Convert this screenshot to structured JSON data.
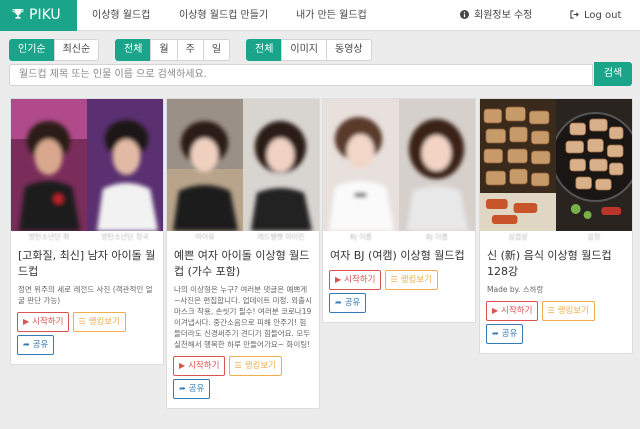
{
  "app": {
    "brand": "PIKU",
    "colors": {
      "accent": "#1aa58a",
      "start": "#d9534f",
      "rank": "#f0ad4e",
      "share": "#337ab7"
    }
  },
  "nav": {
    "items": [
      {
        "label": "이상형 월드컵"
      },
      {
        "label": "이상형 월드컵 만들기"
      },
      {
        "label": "내가 만든 월드컵"
      }
    ],
    "account": {
      "label": "회원정보 수정",
      "icon": "info-circle-icon"
    },
    "logout": {
      "label": "Log out",
      "icon": "sign-out-icon"
    }
  },
  "filters": {
    "sort": [
      {
        "label": "인기순",
        "active": true
      },
      {
        "label": "최신순",
        "active": false
      }
    ],
    "period": [
      {
        "label": "전체",
        "active": true
      },
      {
        "label": "월",
        "active": false
      },
      {
        "label": "주",
        "active": false
      },
      {
        "label": "일",
        "active": false
      }
    ],
    "type": [
      {
        "label": "전체",
        "active": true
      },
      {
        "label": "이미지",
        "active": false
      },
      {
        "label": "동영상",
        "active": false
      }
    ]
  },
  "search": {
    "placeholder": "월드컵 제목 또는 인물 이름 으로 검색하세요.",
    "button": "검색"
  },
  "cards": [
    {
      "title": "[고화질, 최신] 남자 아이돌 월드컵",
      "desc": "정면 위주의 세로 레전드 사진 (객관적인 얼굴 판단 가능)",
      "captions": [
        "방탄소년단 뷔",
        "방탄소년단 정국"
      ],
      "start": "시작하기",
      "rank": "랭킹보기",
      "share": "공유"
    },
    {
      "title": "예쁜 여자 아이돌 이상형 월드컵 (가수 포함)",
      "desc": "나의 이상형은 누구? 여러분 댓글은 예쁘게~사진은 편집합니다. 업데이트 미정. 외출시 마스크 착용, 손씻기 필수! 여러분 코로나19 이겨냅시다. 중간소음으로 피해 안주기! 힘들더라도 신경써주기 견디기 힘들어요. 모두 실천해서 행복한 하루 만들어가요~ 화이팅!",
      "captions": [
        "아이유",
        "레드벨벳 아이린"
      ],
      "start": "시작하기",
      "rank": "랭킹보기",
      "share": "공유"
    },
    {
      "title": "여자 BJ (여캠) 이상형 월드컵",
      "desc": "",
      "captions": [
        "BJ 이름",
        "BJ 이름"
      ],
      "start": "시작하기",
      "rank": "랭킹보기",
      "share": "공유"
    },
    {
      "title": "신 (新) 음식 이상형 월드컵 128강",
      "desc": "Made by. 스하랑",
      "captions": [
        "삼겹살",
        "곱창"
      ],
      "start": "시작하기",
      "rank": "랭킹보기",
      "share": "공유"
    }
  ]
}
